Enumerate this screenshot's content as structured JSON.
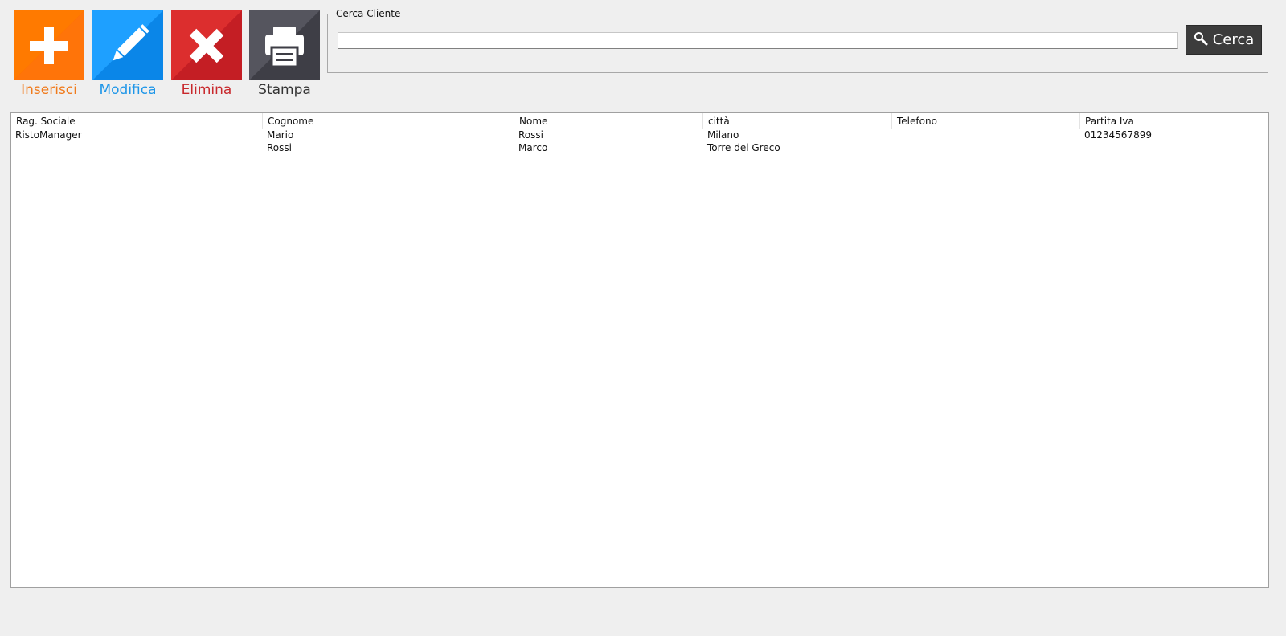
{
  "toolbar": {
    "insert": {
      "label": "Inserisci",
      "icon": "plus-icon",
      "color": "#ff6a00",
      "label_color": "#f07b1d"
    },
    "edit": {
      "label": "Modifica",
      "icon": "pencil-icon",
      "color": "#1a96f0",
      "label_color": "#1e96e8"
    },
    "delete": {
      "label": "Elimina",
      "icon": "close-icon",
      "color": "#d42a2a",
      "label_color": "#c8282c"
    },
    "print": {
      "label": "Stampa",
      "icon": "printer-icon",
      "color": "#4a4a52",
      "label_color": "#333333"
    }
  },
  "search": {
    "group_label": "Cerca Cliente",
    "value": "",
    "placeholder": "",
    "button_label": "Cerca",
    "button_icon": "search-icon"
  },
  "grid": {
    "columns": [
      "Rag. Sociale",
      "Cognome",
      "Nome",
      "città",
      "Telefono",
      "Partita Iva"
    ],
    "rows": [
      [
        "RistoManager",
        "Mario",
        "Rossi",
        "Milano",
        "",
        "01234567899"
      ],
      [
        "",
        "Rossi",
        "Marco",
        "Torre del Greco",
        "",
        ""
      ]
    ]
  }
}
